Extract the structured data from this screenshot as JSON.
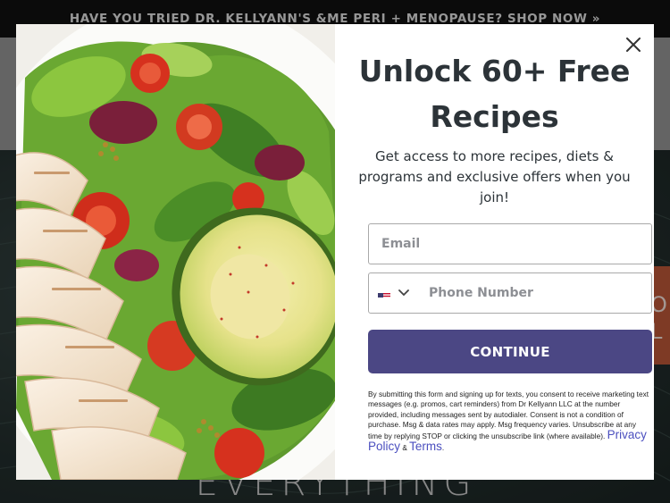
{
  "announcement": {
    "text": "HAVE YOU TRIED DR. KELLYANN'S &ME PERI + MENOPAUSE? SHOP NOW »"
  },
  "hero": {
    "word": "EVERYTHING",
    "badge_text": "O\nL"
  },
  "popup": {
    "image_alt": "Salad bowl with sliced chicken, avocado, tomatoes and greens",
    "title": "Unlock 60+ Free Recipes",
    "subtitle": "Get access to more recipes, diets & programs and exclusive offers when you join!",
    "email_placeholder": "Email",
    "phone_placeholder": "Phone Number",
    "country_flag_icon": "us-flag-icon",
    "continue_label": "CONTINUE",
    "close_icon": "close-icon",
    "disclaimer_text": "By submitting this form and signing up for texts, you consent to receive marketing text messages (e.g. promos, cart reminders) from Dr Kellyann LLC at the number provided, including messages sent by autodialer. Consent is not a condition of purchase. Msg & data rates may apply. Msg frequency varies. Unsubscribe at any time by replying STOP or clicking the unsubscribe link (where available). ",
    "privacy_link": "Privacy Policy",
    "and_text": " & ",
    "terms_link": "Terms",
    "period": "."
  },
  "colors": {
    "button": "#4b4784",
    "title": "#2c3338",
    "link": "#4b4fbf"
  }
}
